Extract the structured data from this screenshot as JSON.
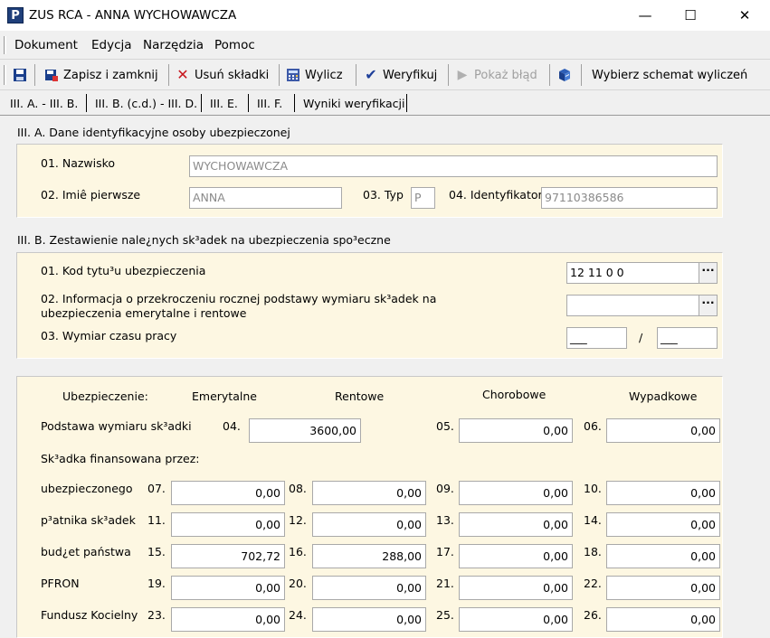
{
  "window": {
    "title": "ZUS RCA - ANNA WYCHOWAWCZA",
    "icon_letter": "P",
    "minimize": "—",
    "maximize": "☐",
    "close": "✕"
  },
  "menu": {
    "items": [
      "Dokument",
      "Edycja",
      "Narzędzia",
      "Pomoc"
    ]
  },
  "toolbar": {
    "save_close": "Zapisz i zamknij",
    "delete": "Usuń składki",
    "calc": "Wylicz",
    "verify": "Weryfikuj",
    "show_error": "Pokaż błąd",
    "schema": "Wybierz schemat wyliczeń"
  },
  "tabs": [
    "III. A. - III. B.",
    "III. B. (c.d.) - III. D.",
    "III. E.",
    "III. F.",
    "Wyniki weryfikacji"
  ],
  "section_a": {
    "title": "III. A. Dane identyfikacyjne osoby ubezpieczonej",
    "nazwisko_label": "01. Nazwisko",
    "nazwisko_value": "WYCHOWAWCZA",
    "imie_label": "02. Imiê pierwsze",
    "imie_value": "ANNA",
    "typ_label": "03. Typ",
    "typ_value": "P",
    "ident_label": "04. Identyfikator",
    "ident_value": "97110386586"
  },
  "section_b": {
    "title": "III. B. Zestawienie nale¿nych sk³adek na ubezpieczenia spo³eczne",
    "kod_label": "01. Kod tytu³u ubezpieczenia",
    "kod_value": "12 11 0 0",
    "info_label_line1": "02. Informacja o przekroczeniu rocznej podstawy wymiaru sk³adek na",
    "info_label_line2": "ubezpieczenia emerytalne i rentowe",
    "info_value": "",
    "wymiar_label": "03. Wymiar czasu pracy",
    "wymiar_num": "___",
    "wymiar_slash": "/",
    "wymiar_den": "___",
    "ellipsis": "···"
  },
  "contrib": {
    "header_label": "Ubezpieczenie:",
    "columns": [
      "Emerytalne",
      "Rentowe",
      "Chorobowe",
      "Wypadkowe"
    ],
    "podstawa_label": "Podstawa wymiaru sk³adki",
    "podstawa": [
      {
        "num": "04.",
        "value": "3600,00"
      },
      {
        "num": "05.",
        "value": "0,00"
      },
      {
        "num": "06.",
        "value": "0,00"
      }
    ],
    "financed_label": "Sk³adka finansowana przez:",
    "rows": [
      {
        "label": "ubezpieczonego",
        "cells": [
          {
            "num": "07.",
            "value": "0,00"
          },
          {
            "num": "08.",
            "value": "0,00"
          },
          {
            "num": "09.",
            "value": "0,00"
          },
          {
            "num": "10.",
            "value": "0,00"
          }
        ]
      },
      {
        "label": "p³atnika sk³adek",
        "cells": [
          {
            "num": "11.",
            "value": "0,00"
          },
          {
            "num": "12.",
            "value": "0,00"
          },
          {
            "num": "13.",
            "value": "0,00"
          },
          {
            "num": "14.",
            "value": "0,00"
          }
        ]
      },
      {
        "label": "bud¿et państwa",
        "cells": [
          {
            "num": "15.",
            "value": "702,72"
          },
          {
            "num": "16.",
            "value": "288,00"
          },
          {
            "num": "17.",
            "value": "0,00"
          },
          {
            "num": "18.",
            "value": "0,00"
          }
        ]
      },
      {
        "label": "PFRON",
        "cells": [
          {
            "num": "19.",
            "value": "0,00"
          },
          {
            "num": "20.",
            "value": "0,00"
          },
          {
            "num": "21.",
            "value": "0,00"
          },
          {
            "num": "22.",
            "value": "0,00"
          }
        ]
      },
      {
        "label": "Fundusz Ko\u0015cielny",
        "cells": [
          {
            "num": "23.",
            "value": "0,00"
          },
          {
            "num": "24.",
            "value": "0,00"
          },
          {
            "num": "25.",
            "value": "0,00"
          },
          {
            "num": "26.",
            "value": "0,00"
          }
        ]
      }
    ]
  },
  "colors": {
    "panel": "#fdf7e2",
    "chrome": "#f0f0f0",
    "app_icon": "#1f3f7a"
  }
}
